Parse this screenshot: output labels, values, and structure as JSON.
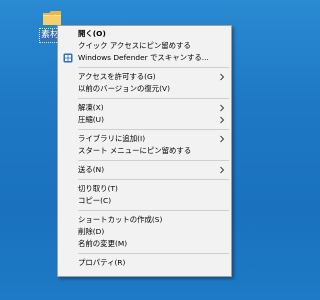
{
  "desktop": {
    "folder_label": "素材",
    "folder_icon": "folder-icon",
    "background_color": "#1e78c4"
  },
  "context_menu": {
    "items": [
      {
        "label": "開く(O)",
        "bold": true
      },
      {
        "label": "クイック アクセスにピン留めする"
      },
      {
        "label": "Windows Defender でスキャンする...",
        "icon": "windows-defender-icon"
      },
      {
        "label": "アクセスを許可する(G)",
        "submenu": true
      },
      {
        "label": "以前のバージョンの復元(V)"
      },
      {
        "label": "解凍(X)",
        "submenu": true
      },
      {
        "label": "圧縮(U)",
        "submenu": true
      },
      {
        "label": "ライブラリに追加(I)",
        "submenu": true
      },
      {
        "label": "スタート メニューにピン留めする"
      },
      {
        "label": "送る(N)",
        "submenu": true
      },
      {
        "label": "切り取り(T)"
      },
      {
        "label": "コピー(C)"
      },
      {
        "label": "ショートカットの作成(S)"
      },
      {
        "label": "削除(D)"
      },
      {
        "label": "名前の変更(M)"
      },
      {
        "label": "プロパティ(R)"
      }
    ]
  }
}
